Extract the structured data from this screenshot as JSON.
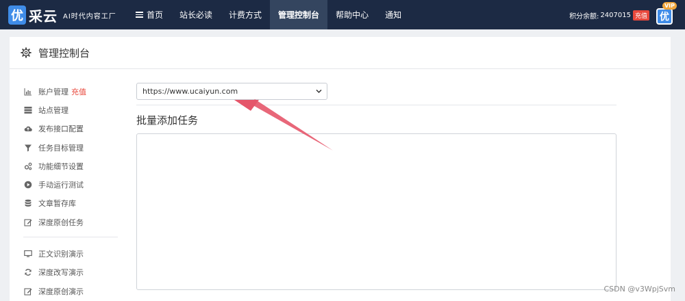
{
  "brand": {
    "badge_char": "优",
    "name": "采云",
    "slogan": "AI时代内容工厂"
  },
  "nav": {
    "items": [
      {
        "label": "首页",
        "icon": "list-icon"
      },
      {
        "label": "站长必读"
      },
      {
        "label": "计费方式"
      },
      {
        "label": "管理控制台",
        "active": true
      },
      {
        "label": "帮助中心"
      },
      {
        "label": "通知"
      }
    ]
  },
  "account": {
    "points_label": "积分余额:",
    "points_value": "2407015",
    "recharge_label": "充值",
    "vip_label": "VIP",
    "avatar_char": "优"
  },
  "panel": {
    "title": "管理控制台",
    "icon": "gear-icon"
  },
  "sidebar": {
    "items": [
      {
        "label": "账户管理",
        "accent": "充值",
        "icon": "bar-chart-icon"
      },
      {
        "label": "站点管理",
        "icon": "server-icon"
      },
      {
        "label": "发布接口配置",
        "icon": "cloud-upload-icon"
      },
      {
        "label": "任务目标管理",
        "icon": "filter-icon"
      },
      {
        "label": "功能细节设置",
        "icon": "gears-icon"
      },
      {
        "label": "手动运行测试",
        "icon": "play-circle-icon"
      },
      {
        "label": "文章暂存库",
        "icon": "database-icon"
      },
      {
        "label": "深度原创任务",
        "icon": "edit-icon"
      }
    ],
    "demo_items": [
      {
        "label": "正文识别演示",
        "icon": "monitor-icon"
      },
      {
        "label": "深度改写演示",
        "icon": "refresh-icon"
      },
      {
        "label": "深度原创演示",
        "icon": "edit-icon"
      }
    ]
  },
  "main": {
    "site_select_value": "https://www.ucaiyun.com",
    "section_title": "批量添加任务",
    "textarea_value": ""
  },
  "colors": {
    "nav_bg": "#1c2a44",
    "nav_active_bg": "#34455f",
    "accent_red": "#e8483c",
    "arrow": "#e5566a",
    "brand_blue": "#3f8ce8"
  },
  "watermark": "CSDN @v3WpjSvm"
}
